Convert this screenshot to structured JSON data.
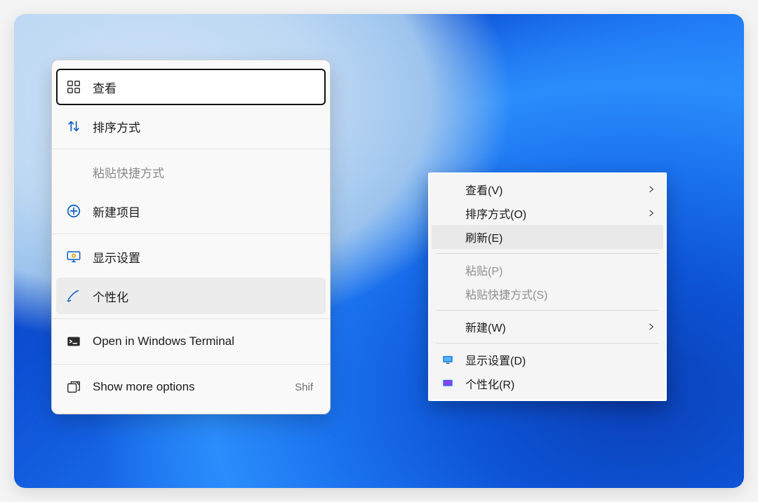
{
  "menu11": {
    "items": {
      "view": {
        "label": "查看"
      },
      "sort": {
        "label": "排序方式"
      },
      "pasteShortcut": {
        "label": "粘贴快捷方式"
      },
      "newItem": {
        "label": "新建项目"
      },
      "displaySettings": {
        "label": "显示设置"
      },
      "personalize": {
        "label": "个性化"
      },
      "terminal": {
        "label": "Open in Windows Terminal"
      },
      "moreOptions": {
        "label": "Show more options",
        "hint": "Shif"
      }
    }
  },
  "classic": {
    "items": {
      "view": {
        "label": "查看(V)"
      },
      "sort": {
        "label": "排序方式(O)"
      },
      "refresh": {
        "label": "刷新(E)"
      },
      "paste": {
        "label": "粘贴(P)"
      },
      "pasteShortcut": {
        "label": "粘贴快捷方式(S)"
      },
      "new": {
        "label": "新建(W)"
      },
      "display": {
        "label": "显示设置(D)"
      },
      "personalize": {
        "label": "个性化(R)"
      }
    }
  }
}
